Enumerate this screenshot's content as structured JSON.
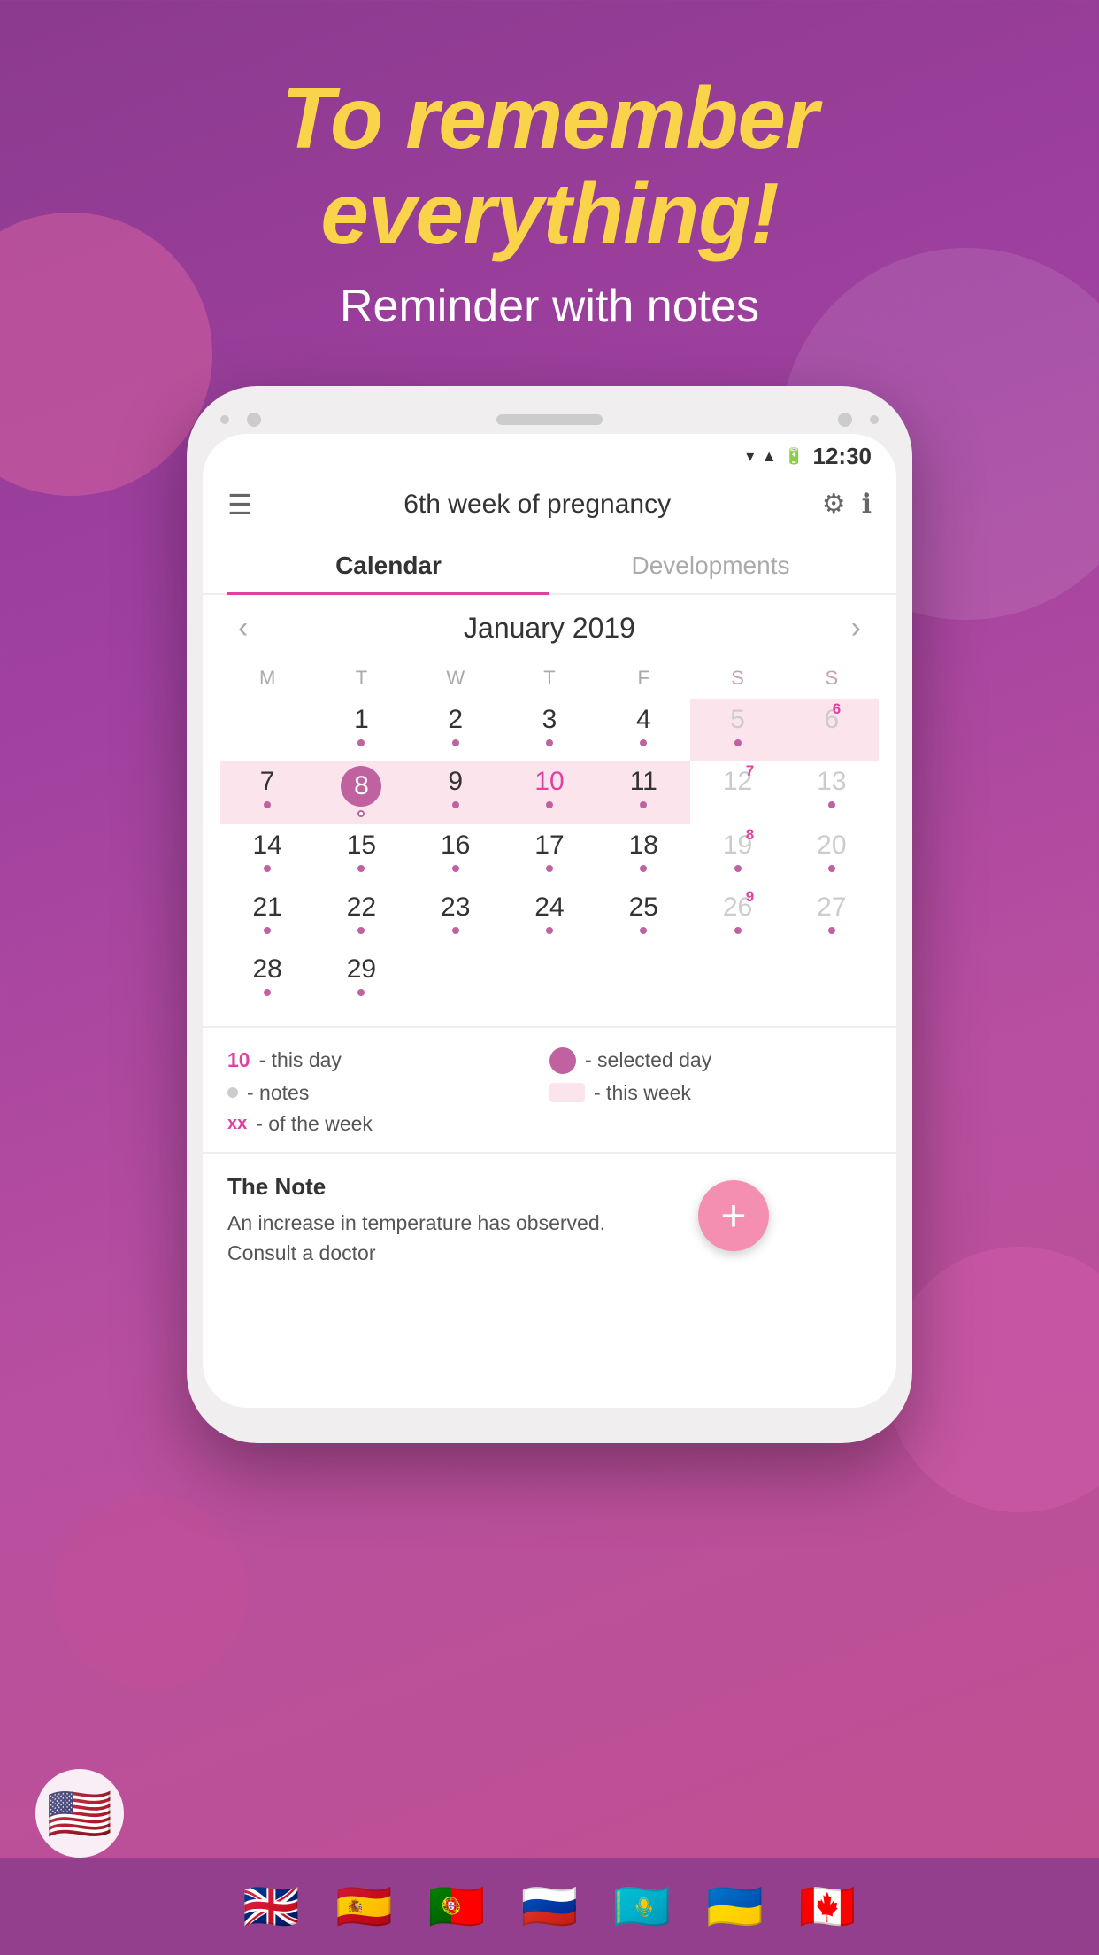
{
  "hero": {
    "title_line1": "To remember",
    "title_line2": "everything!",
    "subtitle": "Reminder with notes"
  },
  "phone": {
    "status_bar": {
      "time": "12:30"
    },
    "app_bar": {
      "title": "6th week of pregnancy"
    },
    "tabs": [
      {
        "label": "Calendar",
        "active": true
      },
      {
        "label": "Developments",
        "active": false
      }
    ],
    "calendar": {
      "month_year": "January 2019",
      "day_headers": [
        "M",
        "T",
        "W",
        "T",
        "F",
        "S",
        "S"
      ],
      "weeks": [
        [
          {
            "date": "1",
            "dot": true,
            "weekend": false,
            "today": false,
            "week_num": null,
            "this_week": false
          },
          {
            "date": "2",
            "dot": true,
            "weekend": false,
            "today": false,
            "week_num": null,
            "this_week": false
          },
          {
            "date": "3",
            "dot": true,
            "weekend": false,
            "today": false,
            "week_num": null,
            "this_week": false
          },
          {
            "date": "4",
            "dot": true,
            "weekend": false,
            "today": false,
            "week_num": null,
            "this_week": false
          },
          {
            "date": "5",
            "dot": true,
            "weekend": true,
            "today": false,
            "week_num": null,
            "this_week": true
          },
          {
            "date": "6",
            "dot": false,
            "weekend": true,
            "today": false,
            "week_num": "6",
            "this_week": true
          },
          {
            "date": "",
            "dot": false,
            "weekend": false,
            "today": false,
            "week_num": null,
            "this_week": false
          }
        ],
        [
          {
            "date": "7",
            "dot": true,
            "weekend": false,
            "today": false,
            "week_num": null,
            "this_week": true
          },
          {
            "date": "8",
            "dot": true,
            "weekend": false,
            "today": true,
            "week_num": null,
            "this_week": true
          },
          {
            "date": "9",
            "dot": true,
            "weekend": false,
            "today": false,
            "week_num": null,
            "this_week": true
          },
          {
            "date": "10",
            "dot": true,
            "weekend": false,
            "today": false,
            "week_num": null,
            "this_week": true,
            "special": "10"
          },
          {
            "date": "11",
            "dot": true,
            "weekend": false,
            "today": false,
            "week_num": null,
            "this_week": true
          },
          {
            "date": "12",
            "dot": false,
            "weekend": true,
            "today": false,
            "week_num": "7",
            "this_week": false
          },
          {
            "date": "13",
            "dot": true,
            "weekend": true,
            "today": false,
            "week_num": null,
            "this_week": false
          }
        ],
        [
          {
            "date": "14",
            "dot": true,
            "weekend": false,
            "today": false,
            "week_num": null,
            "this_week": false
          },
          {
            "date": "15",
            "dot": true,
            "weekend": false,
            "today": false,
            "week_num": null,
            "this_week": false
          },
          {
            "date": "16",
            "dot": true,
            "weekend": false,
            "today": false,
            "week_num": null,
            "this_week": false
          },
          {
            "date": "17",
            "dot": true,
            "weekend": false,
            "today": false,
            "week_num": null,
            "this_week": false
          },
          {
            "date": "18",
            "dot": true,
            "weekend": false,
            "today": false,
            "week_num": null,
            "this_week": false
          },
          {
            "date": "19",
            "dot": true,
            "weekend": true,
            "today": false,
            "week_num": "8",
            "this_week": false
          },
          {
            "date": "20",
            "dot": true,
            "weekend": true,
            "today": false,
            "week_num": null,
            "this_week": false
          }
        ],
        [
          {
            "date": "21",
            "dot": true,
            "weekend": false,
            "today": false,
            "week_num": null,
            "this_week": false
          },
          {
            "date": "22",
            "dot": true,
            "weekend": false,
            "today": false,
            "week_num": null,
            "this_week": false
          },
          {
            "date": "23",
            "dot": true,
            "weekend": false,
            "today": false,
            "week_num": null,
            "this_week": false
          },
          {
            "date": "24",
            "dot": true,
            "weekend": false,
            "today": false,
            "week_num": null,
            "this_week": false
          },
          {
            "date": "25",
            "dot": true,
            "weekend": false,
            "today": false,
            "week_num": null,
            "this_week": false
          },
          {
            "date": "26",
            "dot": true,
            "weekend": true,
            "today": false,
            "week_num": "9",
            "this_week": false
          },
          {
            "date": "27",
            "dot": true,
            "weekend": true,
            "today": false,
            "week_num": null,
            "this_week": false
          }
        ],
        [
          {
            "date": "28",
            "dot": true,
            "weekend": false,
            "today": false,
            "week_num": null,
            "this_week": false
          },
          {
            "date": "29",
            "dot": true,
            "weekend": false,
            "today": false,
            "week_num": null,
            "this_week": false
          },
          {
            "date": "",
            "dot": false,
            "weekend": false,
            "today": false,
            "week_num": null,
            "this_week": false
          },
          {
            "date": "",
            "dot": false,
            "weekend": false,
            "today": false,
            "week_num": null,
            "this_week": false
          },
          {
            "date": "",
            "dot": false,
            "weekend": false,
            "today": false,
            "week_num": null,
            "this_week": false
          },
          {
            "date": "",
            "dot": false,
            "weekend": false,
            "today": false,
            "week_num": null,
            "this_week": false
          },
          {
            "date": "",
            "dot": false,
            "weekend": false,
            "today": false,
            "week_num": null,
            "this_week": false
          }
        ]
      ]
    },
    "legend": {
      "items": [
        {
          "symbol": "10",
          "type": "colored-num",
          "description": "- this day"
        },
        {
          "symbol": "circle",
          "type": "circle",
          "description": "- selected day"
        },
        {
          "symbol": "dot",
          "type": "dot",
          "description": "- notes"
        },
        {
          "symbol": "week",
          "type": "week-bar",
          "description": "- this week"
        },
        {
          "symbol": "xx",
          "type": "xx",
          "description": "- of the week"
        }
      ]
    },
    "note": {
      "title": "The Note",
      "text": "An increase in temperature has observed.\nConsult a doctor"
    },
    "fab_label": "+"
  },
  "flags": [
    "🇺🇸",
    "🇬🇧",
    "🇪🇸",
    "🇵🇹",
    "🇷🇺",
    "🇰🇿",
    "🇺🇦",
    "🇨🇦"
  ],
  "us_corner_flag": "🇺🇸"
}
